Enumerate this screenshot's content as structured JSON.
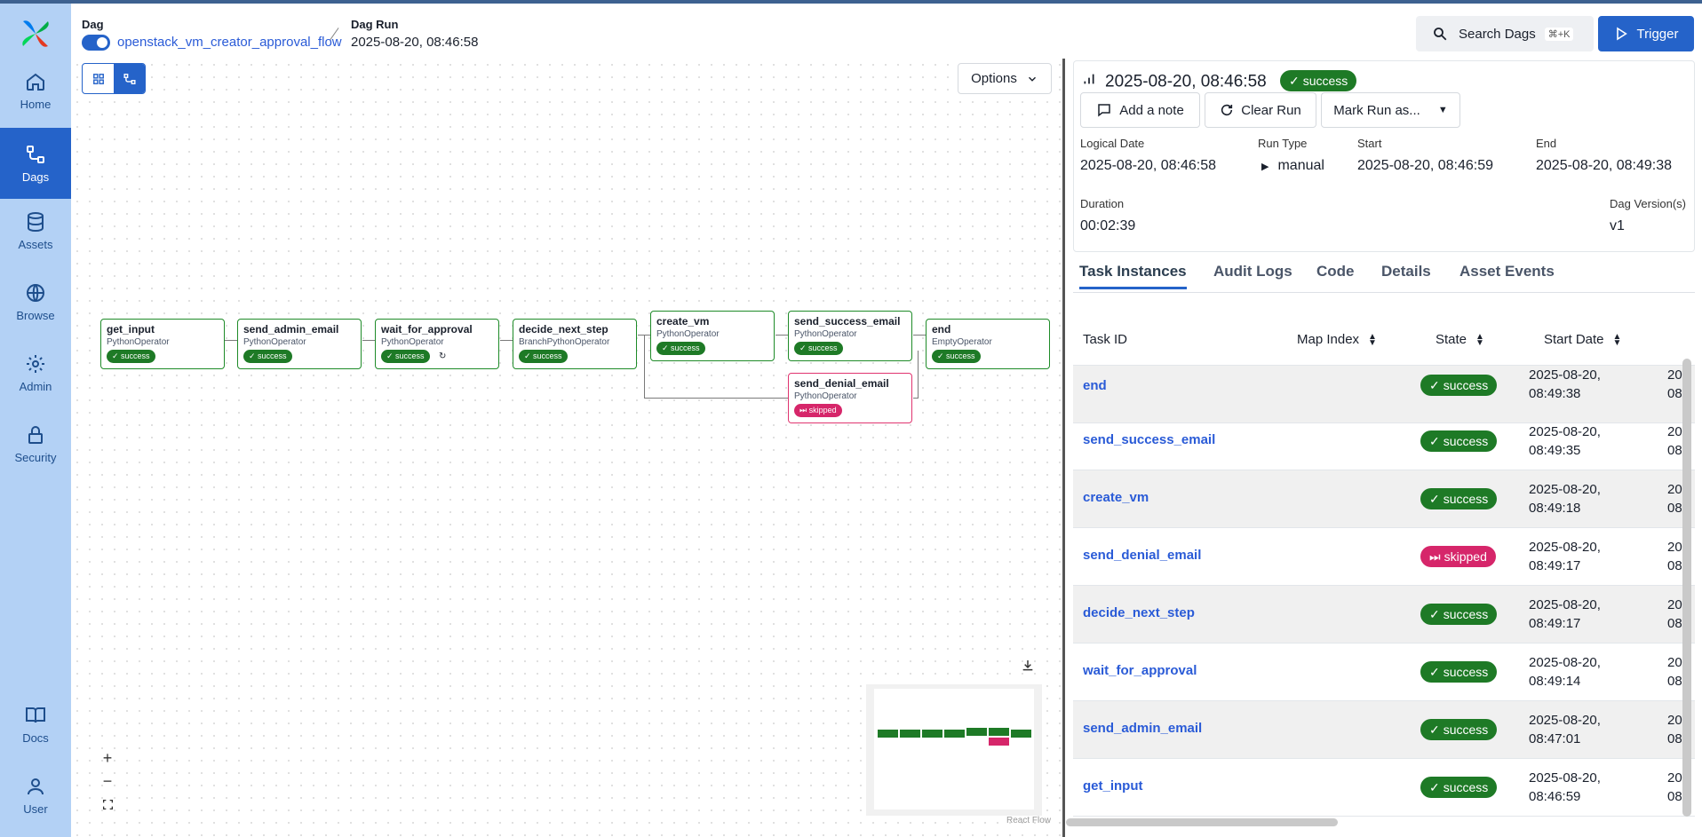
{
  "nav": [
    {
      "label": "Home",
      "icon": "home-icon"
    },
    {
      "label": "Dags",
      "icon": "dags-icon"
    },
    {
      "label": "Assets",
      "icon": "database-icon"
    },
    {
      "label": "Browse",
      "icon": "globe-icon"
    },
    {
      "label": "Admin",
      "icon": "gear-icon"
    },
    {
      "label": "Security",
      "icon": "lock-icon"
    },
    {
      "label": "Docs",
      "icon": "book-icon"
    },
    {
      "label": "User",
      "icon": "user-icon"
    }
  ],
  "header": {
    "dag_title": "Dag",
    "dag_name": "openstack_vm_creator_approval_flow",
    "run_title": "Dag Run",
    "run_date": "2025-08-20, 08:46:58",
    "search_label": "Search Dags",
    "search_shortcut": "⌘+K",
    "trigger_label": "Trigger"
  },
  "graph": {
    "options_label": "Options",
    "attribution": "React Flow",
    "nodes": [
      {
        "name": "get_input",
        "operator": "PythonOperator",
        "state": "success"
      },
      {
        "name": "send_admin_email",
        "operator": "PythonOperator",
        "state": "success"
      },
      {
        "name": "wait_for_approval",
        "operator": "PythonOperator",
        "state": "success"
      },
      {
        "name": "decide_next_step",
        "operator": "BranchPythonOperator",
        "state": "success"
      },
      {
        "name": "create_vm",
        "operator": "PythonOperator",
        "state": "success"
      },
      {
        "name": "send_success_email",
        "operator": "PythonOperator",
        "state": "success"
      },
      {
        "name": "send_denial_email",
        "operator": "PythonOperator",
        "state": "skipped"
      },
      {
        "name": "end",
        "operator": "EmptyOperator",
        "state": "success"
      }
    ]
  },
  "run": {
    "title": "2025-08-20, 08:46:58",
    "state": "success",
    "add_note": "Add a note",
    "clear_run": "Clear Run",
    "mark_run": "Mark Run as...",
    "logical_date_label": "Logical Date",
    "logical_date": "2025-08-20, 08:46:58",
    "run_type_label": "Run Type",
    "run_type": "manual",
    "start_label": "Start",
    "start": "2025-08-20, 08:46:59",
    "end_label": "End",
    "end": "2025-08-20, 08:49:38",
    "duration_label": "Duration",
    "duration": "00:02:39",
    "version_label": "Dag Version(s)",
    "version": "v1"
  },
  "tabs": [
    "Task Instances",
    "Audit Logs",
    "Code",
    "Details",
    "Asset Events"
  ],
  "table": {
    "columns": [
      "Task ID",
      "Map Index",
      "State",
      "Start Date"
    ],
    "rows": [
      {
        "task_id": "end",
        "state": "success",
        "date": "2025-08-20,",
        "time": "08:49:38",
        "cut1": "20",
        "cut2": "08"
      },
      {
        "task_id": "send_success_email",
        "state": "success",
        "date": "2025-08-20,",
        "time": "08:49:35",
        "cut1": "20",
        "cut2": "08"
      },
      {
        "task_id": "create_vm",
        "state": "success",
        "date": "2025-08-20,",
        "time": "08:49:18",
        "cut1": "20",
        "cut2": "08"
      },
      {
        "task_id": "send_denial_email",
        "state": "skipped",
        "date": "2025-08-20,",
        "time": "08:49:17",
        "cut1": "20",
        "cut2": "08"
      },
      {
        "task_id": "decide_next_step",
        "state": "success",
        "date": "2025-08-20,",
        "time": "08:49:17",
        "cut1": "20",
        "cut2": "08"
      },
      {
        "task_id": "wait_for_approval",
        "state": "success",
        "date": "2025-08-20,",
        "time": "08:49:14",
        "cut1": "20",
        "cut2": "08"
      },
      {
        "task_id": "send_admin_email",
        "state": "success",
        "date": "2025-08-20,",
        "time": "08:47:01",
        "cut1": "20",
        "cut2": "08"
      },
      {
        "task_id": "get_input",
        "state": "success",
        "date": "2025-08-20,",
        "time": "08:46:59",
        "cut1": "20",
        "cut2": "08"
      }
    ]
  },
  "colors": {
    "accent": "#2563c9",
    "success": "#1e7a26",
    "skipped": "#d6266a",
    "sidebar": "#b3d1f5"
  }
}
